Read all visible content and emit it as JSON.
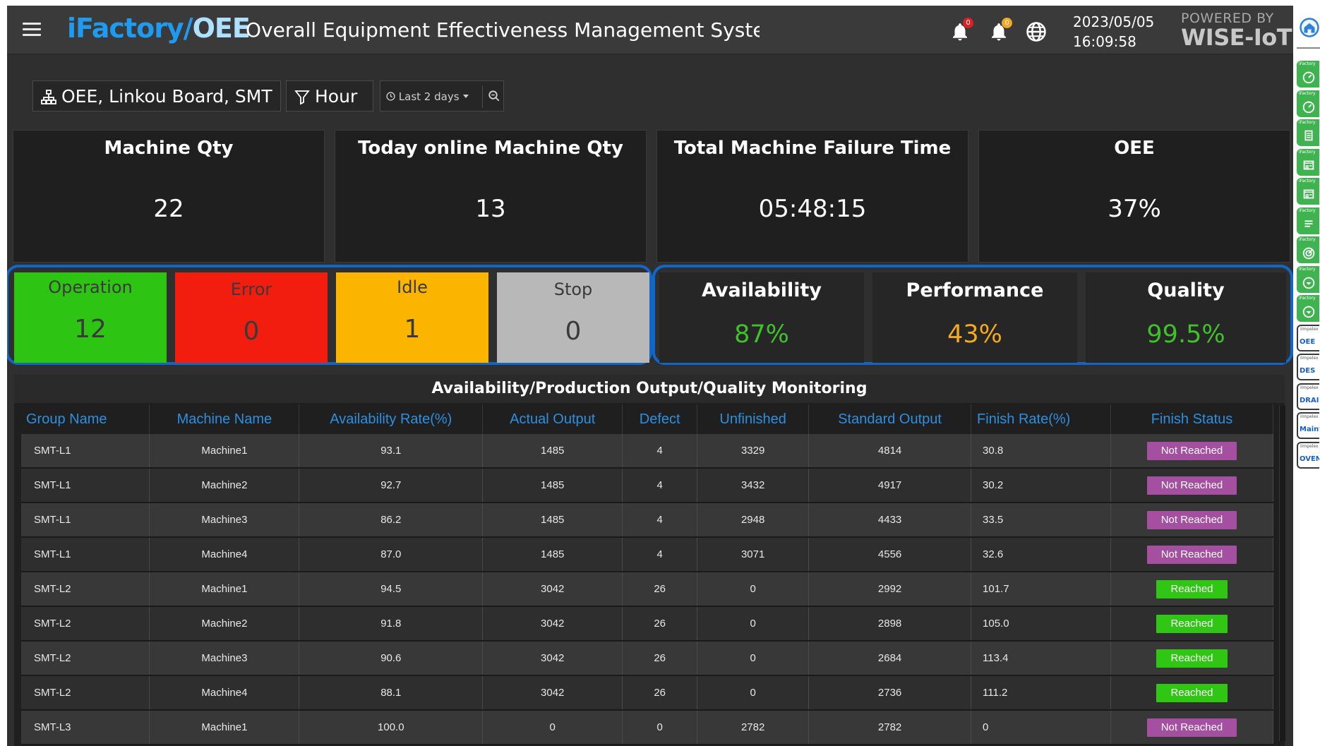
{
  "header": {
    "logo_main": "iFactory/",
    "logo_suffix": "OEE",
    "title": "Overall Equipment Effectiveness Management System",
    "notif1_count": "0",
    "notif2_count": "0",
    "date": "2023/05/05",
    "time": "16:09:58",
    "powered_line1": "POWERED BY",
    "powered_line2": "WISE-IoT",
    "icons": [
      "menu-icon",
      "bell-icon",
      "bell-icon",
      "globe-icon",
      "home-icon"
    ],
    "badge_colors": {
      "notif1": "#e02020",
      "notif2": "#f5a623"
    }
  },
  "filters": {
    "group": "OEE, Linkou Board, SMT",
    "interval": "Hour",
    "range": "Last 2 days"
  },
  "kpis": [
    {
      "label": "Machine Qty",
      "value": "22"
    },
    {
      "label": "Today online Machine Qty",
      "value": "13"
    },
    {
      "label": "Total Machine Failure Time",
      "value": "05:48:15"
    },
    {
      "label": "OEE",
      "value": "37%"
    }
  ],
  "status": [
    {
      "label": "Operation",
      "value": "12",
      "color": "#2ec414"
    },
    {
      "label": "Error",
      "value": "0",
      "color": "#f21d0f"
    },
    {
      "label": "Idle",
      "value": "1",
      "color": "#fbb400"
    },
    {
      "label": "Stop",
      "value": "0",
      "color": "#b8b8b8"
    }
  ],
  "metrics": [
    {
      "label": "Availability",
      "value": "87%",
      "color": "#3fc12b"
    },
    {
      "label": "Performance",
      "value": "43%",
      "color": "#f6a91c"
    },
    {
      "label": "Quality",
      "value": "99.5%",
      "color": "#3fc12b"
    }
  ],
  "table": {
    "title": "Availability/Production Output/Quality Monitoring",
    "columns": [
      "Group Name",
      "Machine Name",
      "Availability Rate(%)",
      "Actual Output",
      "Defect",
      "Unfinished",
      "Standard Output",
      "Finish Rate(%)",
      "Finish Status"
    ],
    "rows": [
      [
        "SMT-L1",
        "Machine1",
        "93.1",
        "1485",
        "4",
        "3329",
        "4814",
        "30.8",
        "Not Reached"
      ],
      [
        "SMT-L1",
        "Machine2",
        "92.7",
        "1485",
        "4",
        "3432",
        "4917",
        "30.2",
        "Not Reached"
      ],
      [
        "SMT-L1",
        "Machine3",
        "86.2",
        "1485",
        "4",
        "2948",
        "4433",
        "33.5",
        "Not Reached"
      ],
      [
        "SMT-L1",
        "Machine4",
        "87.0",
        "1485",
        "4",
        "3071",
        "4556",
        "32.6",
        "Not Reached"
      ],
      [
        "SMT-L2",
        "Machine1",
        "94.5",
        "3042",
        "26",
        "0",
        "2992",
        "101.7",
        "Reached"
      ],
      [
        "SMT-L2",
        "Machine2",
        "91.8",
        "3042",
        "26",
        "0",
        "2898",
        "105.0",
        "Reached"
      ],
      [
        "SMT-L2",
        "Machine3",
        "90.6",
        "3042",
        "26",
        "0",
        "2684",
        "113.4",
        "Reached"
      ],
      [
        "SMT-L2",
        "Machine4",
        "88.1",
        "3042",
        "26",
        "0",
        "2736",
        "111.2",
        "Reached"
      ],
      [
        "SMT-L3",
        "Machine1",
        "100.0",
        "0",
        "0",
        "2782",
        "2782",
        "0",
        "Not Reached"
      ]
    ],
    "status_colors": {
      "Reached": "#2fc614",
      "Not Reached": "#a44fa0"
    }
  },
  "dock": {
    "items": [
      {
        "icon": "gauge-icon",
        "tag": "iFactory",
        "label": ""
      },
      {
        "icon": "gauge-icon",
        "tag": "iFactory",
        "label": ""
      },
      {
        "icon": "document-icon",
        "tag": "iFactory",
        "label": ""
      },
      {
        "icon": "window-icon",
        "tag": "iFactory",
        "label": ""
      },
      {
        "icon": "window-icon",
        "tag": "iFactory",
        "label": ""
      },
      {
        "icon": "list-icon",
        "tag": "iFactory",
        "label": ""
      },
      {
        "icon": "target-icon",
        "tag": "iFactory",
        "label": ""
      },
      {
        "icon": "shield-icon",
        "tag": "iFactory",
        "label": ""
      },
      {
        "icon": "shield-icon",
        "tag": "iFactory",
        "label": ""
      },
      {
        "icon": "app-icon",
        "tag": "iImpelex",
        "label": "OEE"
      },
      {
        "icon": "app-icon",
        "tag": "iImpelex",
        "label": "DES"
      },
      {
        "icon": "app-icon",
        "tag": "iImpelex",
        "label": "DRAIN"
      },
      {
        "icon": "app-icon",
        "tag": "iImpelex",
        "label": "Maintai"
      },
      {
        "icon": "app-icon",
        "tag": "iImpelex",
        "label": "OVEN"
      }
    ]
  }
}
